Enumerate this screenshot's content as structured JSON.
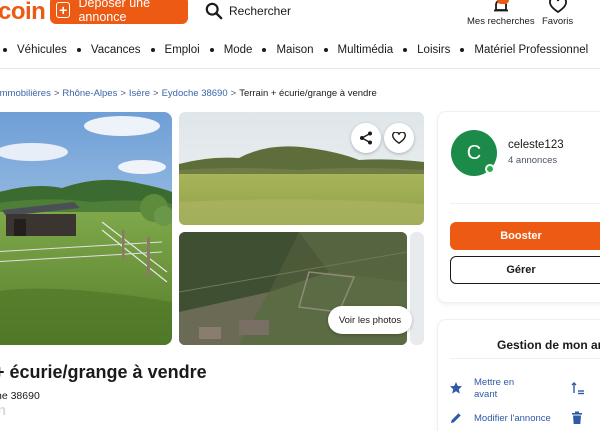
{
  "header": {
    "logo": "coin",
    "post_button": "Déposer une annonce",
    "search_label": "Rechercher",
    "saved_searches": "Mes recherches",
    "favorites": "Favoris"
  },
  "nav": {
    "items": [
      "Véhicules",
      "Vacances",
      "Emploi",
      "Mode",
      "Maison",
      "Multimédia",
      "Loisirs",
      "Matériel Professionnel"
    ]
  },
  "breadcrumb": {
    "items": [
      "Immobilières",
      "Rhône-Alpes",
      "Isère",
      "Eydoche 38690"
    ],
    "separator": ">",
    "current": "Terrain + écurie/grange à vendre"
  },
  "gallery": {
    "see_photos": "Voir les photos"
  },
  "listing": {
    "title": "+ écurie/grange à vendre",
    "location": "he 38690",
    "watermark": "n"
  },
  "seller": {
    "initial": "C",
    "name": "celeste123",
    "listings_count": "4 annonces",
    "boost_button": "Booster",
    "manage_button": "Gérer"
  },
  "management": {
    "title": "Gestion de mon an",
    "actions": {
      "highlight": "Mettre en avant",
      "edit": "Modifier l'annonce"
    }
  },
  "colors": {
    "accent": "#ec5a13",
    "avatar": "#1c8b4a",
    "link": "#3b64a8"
  }
}
